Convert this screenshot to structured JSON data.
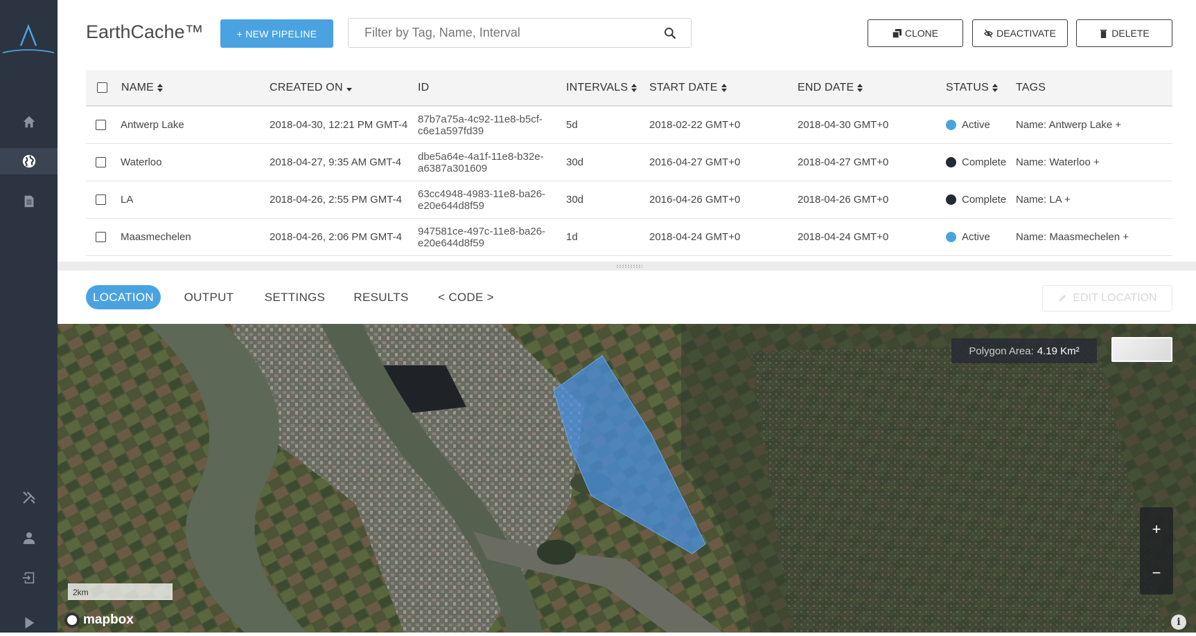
{
  "app": {
    "title": "EarthCache™",
    "new_pipeline_label": "+ NEW PIPELINE",
    "search_placeholder": "Filter by Tag, Name, Interval",
    "actions": {
      "clone": "CLONE",
      "deactivate": "DEACTIVATE",
      "delete": "DELETE"
    }
  },
  "sidebar": {
    "items": [
      {
        "name": "home",
        "icon": "home-icon"
      },
      {
        "name": "globe",
        "icon": "globe-icon",
        "active": true
      },
      {
        "name": "documents",
        "icon": "document-icon"
      },
      {
        "name": "tools",
        "icon": "tools-icon"
      },
      {
        "name": "account",
        "icon": "user-icon"
      },
      {
        "name": "logout",
        "icon": "logout-icon"
      },
      {
        "name": "play",
        "icon": "play-icon"
      }
    ]
  },
  "table": {
    "columns": [
      "NAME",
      "CREATED ON",
      "ID",
      "INTERVALS",
      "START DATE",
      "END DATE",
      "STATUS",
      "TAGS"
    ],
    "rows": [
      {
        "name": "Antwerp Lake",
        "created": "2018-04-30, 12:21 PM GMT-4",
        "id": "87b7a75a-4c92-11e8-b5cf-c6e1a597fd39",
        "interval": "5d",
        "start": "2018-02-22 GMT+0",
        "end": "2018-04-30 GMT+0",
        "status": "Active",
        "status_color": "#4aa3e0",
        "tags": "Name: Antwerp Lake +"
      },
      {
        "name": "Waterloo",
        "created": "2018-04-27, 9:35 AM GMT-4",
        "id": "dbe5a64e-4a1f-11e8-b32e-a6387a301609",
        "interval": "30d",
        "start": "2016-04-27 GMT+0",
        "end": "2018-04-27 GMT+0",
        "status": "Complete",
        "status_color": "#222a33",
        "tags": "Name: Waterloo +"
      },
      {
        "name": "LA",
        "created": "2018-04-26, 2:55 PM GMT-4",
        "id": "63cc4948-4983-11e8-ba26-e20e644d8f59",
        "interval": "30d",
        "start": "2016-04-26 GMT+0",
        "end": "2018-04-26 GMT+0",
        "status": "Complete",
        "status_color": "#222a33",
        "tags": "Name: LA +"
      },
      {
        "name": "Maasmechelen",
        "created": "2018-04-26, 2:06 PM GMT-4",
        "id": "947581ce-497c-11e8-ba26-e20e644d8f59",
        "interval": "1d",
        "start": "2018-04-24 GMT+0",
        "end": "2018-04-24 GMT+0",
        "status": "Active",
        "status_color": "#4aa3e0",
        "tags": "Name: Maasmechelen +"
      }
    ]
  },
  "tabs": [
    {
      "label": "LOCATION",
      "active": true
    },
    {
      "label": "OUTPUT"
    },
    {
      "label": "SETTINGS"
    },
    {
      "label": "RESULTS"
    },
    {
      "label": "< CODE >"
    }
  ],
  "edit_location_label": "EDIT LOCATION",
  "map": {
    "polygon_area_label": "Polygon Area:",
    "polygon_area_value": "4.19 Km²",
    "scale_label": "2km",
    "attribution": "mapbox",
    "zoom_in": "+",
    "zoom_out": "−",
    "info": "i",
    "polygon_color": "#4a90e2"
  }
}
